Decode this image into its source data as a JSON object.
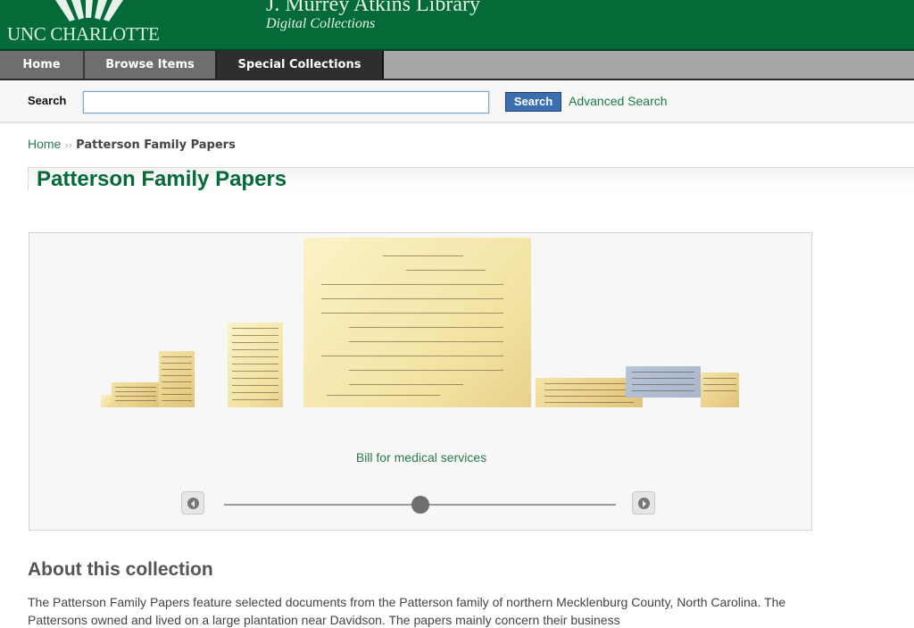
{
  "header": {
    "logo_text": "UNC CHARLOTTE",
    "library_title": "J. Murrey Atkins Library",
    "library_subtitle": "Digital Collections",
    "brand_color": "#046a38"
  },
  "nav": {
    "items": [
      {
        "label": "Home"
      },
      {
        "label": "Browse Items"
      },
      {
        "label": "Special Collections",
        "active": true
      }
    ]
  },
  "search": {
    "label": "Search",
    "value": "",
    "placeholder": "",
    "button_label": "Search",
    "advanced_label": "Advanced Search"
  },
  "breadcrumb": {
    "home": "Home",
    "separator": "››",
    "current": "Patterson Family Papers"
  },
  "page": {
    "title": "Patterson Family Papers"
  },
  "carousel": {
    "caption": "Bill for medical services",
    "items": [
      {
        "type": "document-thumbnail",
        "tone": "light"
      },
      {
        "type": "document-thumbnail",
        "tone": "aged"
      },
      {
        "type": "document-thumbnail",
        "tone": "aged"
      },
      {
        "type": "document-thumbnail",
        "tone": "light"
      },
      {
        "type": "document-thumbnail",
        "tone": "light",
        "selected": true
      },
      {
        "type": "document-thumbnail",
        "tone": "aged"
      },
      {
        "type": "document-thumbnail",
        "tone": "blue"
      },
      {
        "type": "document-thumbnail",
        "tone": "aged"
      }
    ],
    "slider_position": 0.5,
    "prev_icon": "arrow-left-icon",
    "next_icon": "arrow-right-icon"
  },
  "about": {
    "title": "About this collection",
    "text": "The Patterson Family Papers feature selected documents from the Patterson family of northern Mecklenburg County, North Carolina. The Pattersons owned and lived on a large plantation near Davidson. The papers mainly concern their business"
  }
}
